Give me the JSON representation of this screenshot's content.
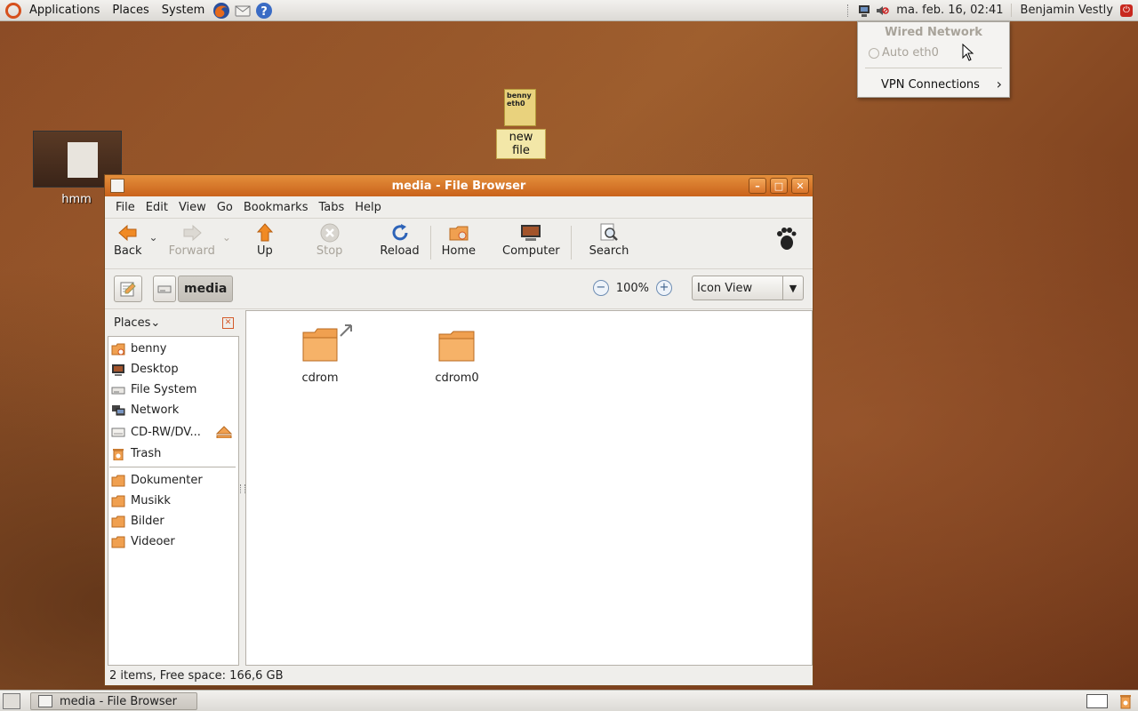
{
  "top_panel": {
    "menus": [
      "Applications",
      "Places",
      "System"
    ],
    "clock": "ma. feb. 16, 02:41",
    "user": "Benjamin Vestly"
  },
  "network_menu": {
    "header": "Wired Network",
    "auto_item": "Auto eth0",
    "vpn_item": "VPN Connections"
  },
  "desktop": {
    "icons": [
      {
        "label": "hmm"
      },
      {
        "label": "new file",
        "preview_text": "benny\neth0"
      }
    ]
  },
  "window": {
    "title": "media - File Browser",
    "menubar": [
      "File",
      "Edit",
      "View",
      "Go",
      "Bookmarks",
      "Tabs",
      "Help"
    ],
    "toolbar": {
      "back": "Back",
      "forward": "Forward",
      "up": "Up",
      "stop": "Stop",
      "reload": "Reload",
      "home": "Home",
      "computer": "Computer",
      "search": "Search"
    },
    "location": {
      "current": "media",
      "zoom": "100%",
      "view_mode": "Icon View"
    },
    "sidebar": {
      "title": "Places",
      "places": [
        "benny",
        "Desktop",
        "File System",
        "Network",
        "CD-RW/DV...",
        "Trash"
      ],
      "bookmarks": [
        "Dokumenter",
        "Musikk",
        "Bilder",
        "Videoer"
      ]
    },
    "files": [
      {
        "name": "cdrom",
        "type": "folder-link"
      },
      {
        "name": "cdrom0",
        "type": "folder"
      }
    ],
    "status": "2 items, Free space: 166,6 GB"
  },
  "bottom_panel": {
    "task": "media - File Browser"
  },
  "colors": {
    "title_bar": "#d8762b",
    "folder": "#f0a050",
    "desktop": "#8a4a25"
  }
}
